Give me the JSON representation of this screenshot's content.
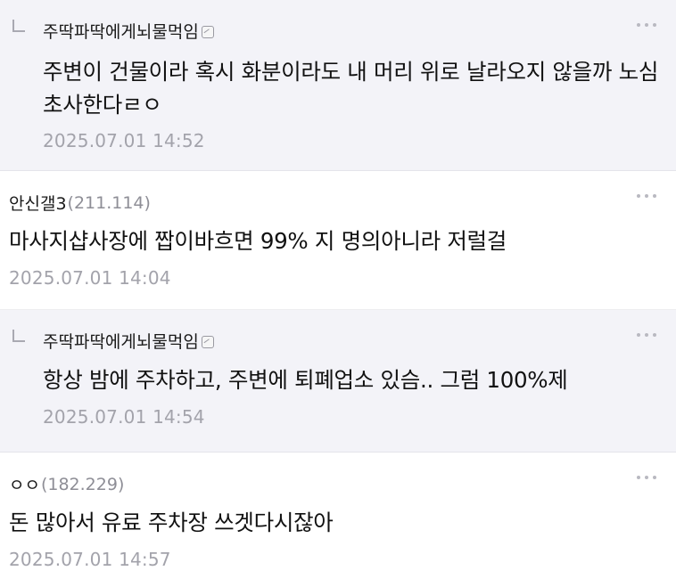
{
  "comments": [
    {
      "author": "주딱파딱에게뇌물먹임",
      "text": "주변이 건물이라 혹시 화분이라도 내 머리 위로 날라오지 않을까 노심초사한다ㄹㅇ",
      "date": "2025.07.01 14:52"
    },
    {
      "author": "안신갤3",
      "ip": "(211.114)",
      "text": "마사지샵사장에 짭이바흐면 99% 지 명의아니라 저럴걸",
      "date": "2025.07.01 14:04"
    },
    {
      "author": "주딱파딱에게뇌물먹임",
      "text": "항상 밤에 주차하고, 주변에 퇴폐업소 있슴.. 그럼 100%제",
      "date": "2025.07.01 14:54"
    },
    {
      "author": "ㅇㅇ",
      "ip": "(182.229)",
      "text": "돈 많아서 유료 주차장 쓰겟다시잖아",
      "date": "2025.07.01 14:57"
    }
  ]
}
